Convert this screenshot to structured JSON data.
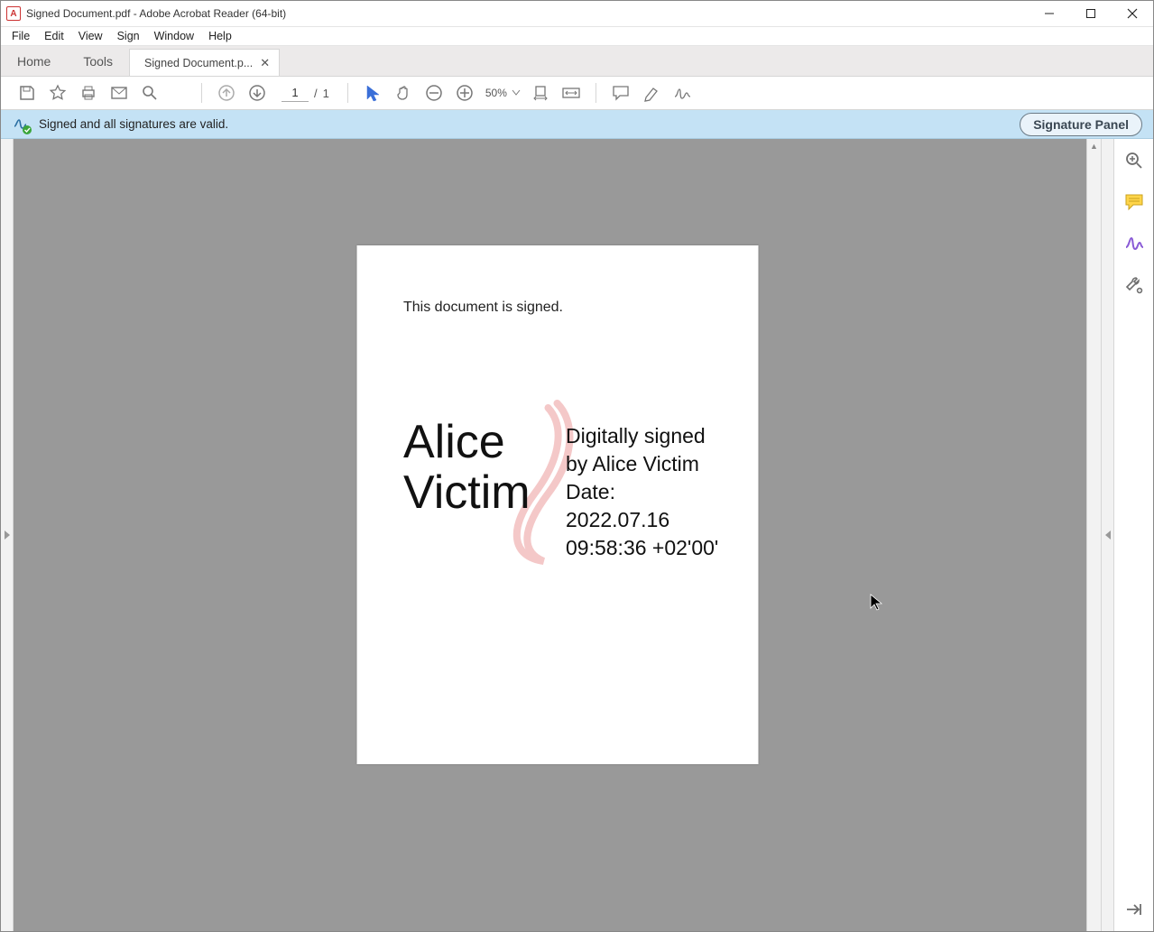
{
  "window": {
    "title": "Signed Document.pdf - Adobe Acrobat Reader (64-bit)"
  },
  "menubar": [
    "File",
    "Edit",
    "View",
    "Sign",
    "Window",
    "Help"
  ],
  "tabs": {
    "home": "Home",
    "tools": "Tools",
    "active": "Signed Document.p..."
  },
  "toolbar": {
    "page_current": "1",
    "page_total": "1",
    "page_sep": "/",
    "zoom": "50%"
  },
  "signature_banner": {
    "message": "Signed and all signatures are valid.",
    "panel_button": "Signature Panel"
  },
  "document": {
    "body_text": "This document is signed.",
    "signer_name": "Alice Victim",
    "detail_line1": "Digitally signed",
    "detail_line2": "by Alice Victim",
    "detail_line3": "Date:",
    "detail_line4": "2022.07.16",
    "detail_line5": "09:58:36 +02'00'"
  }
}
